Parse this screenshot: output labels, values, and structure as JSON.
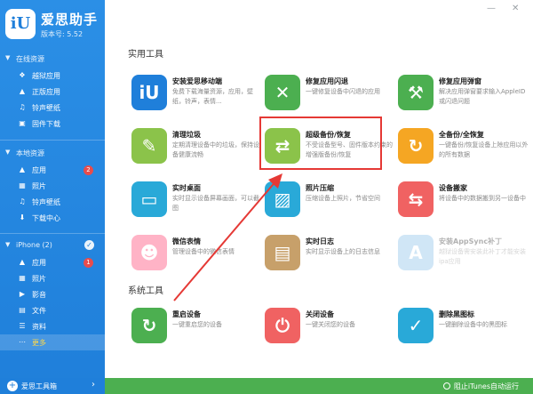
{
  "app": {
    "title": "爱思助手",
    "version": "版本号: 5.52",
    "logo_text": "iU"
  },
  "window_controls": {
    "minimize": "—",
    "close": "✕"
  },
  "sidebar": {
    "sections": [
      {
        "label": "在线资源",
        "items": [
          {
            "label": "越狱应用",
            "icon": "jailbreak-icon",
            "glyph": "❖"
          },
          {
            "label": "正版应用",
            "icon": "apps-icon",
            "glyph": "▲"
          },
          {
            "label": "铃声壁纸",
            "icon": "ringtone-icon",
            "glyph": "♫"
          },
          {
            "label": "固件下载",
            "icon": "firmware-icon",
            "glyph": "▣"
          }
        ]
      },
      {
        "label": "本地资源",
        "items": [
          {
            "label": "应用",
            "icon": "apps-icon",
            "glyph": "▲",
            "badge": "2"
          },
          {
            "label": "照片",
            "icon": "photos-icon",
            "glyph": "▦"
          },
          {
            "label": "铃声壁纸",
            "icon": "ringtone-icon",
            "glyph": "♫"
          },
          {
            "label": "下载中心",
            "icon": "download-icon",
            "glyph": "⬇"
          }
        ]
      },
      {
        "label": "iPhone (2)",
        "items": [
          {
            "label": "应用",
            "icon": "apps-icon",
            "glyph": "▲",
            "badge": "1"
          },
          {
            "label": "照片",
            "icon": "photos-icon",
            "glyph": "▦"
          },
          {
            "label": "影音",
            "icon": "media-icon",
            "glyph": "▶"
          },
          {
            "label": "文件",
            "icon": "files-icon",
            "glyph": "▤"
          },
          {
            "label": "资料",
            "icon": "data-icon",
            "glyph": "☰"
          },
          {
            "label": "更多",
            "icon": "more-icon",
            "glyph": "⋯",
            "active": true
          }
        ]
      }
    ]
  },
  "bottom": {
    "toolbox": "爱思工具箱",
    "itunes": "阻止iTunes自动运行"
  },
  "main": {
    "section1": "实用工具",
    "section2": "系统工具",
    "tools": [
      {
        "name": "安装爱思移动端",
        "desc": "免费下载海量资源，应用，壁纸，铃声，表情...",
        "color": "#1f7fda",
        "glyph": "iU",
        "icon": "aisi-mobile-icon"
      },
      {
        "name": "修复应用闪退",
        "desc": "一键修复设备中闪退的应用",
        "color": "#4caf50",
        "glyph": "✕",
        "icon": "repair-crash-icon"
      },
      {
        "name": "修复应用弹窗",
        "desc": "解决应用弹窗要求输入AppleID或闪退问题",
        "color": "#4caf50",
        "glyph": "⚒",
        "icon": "repair-popup-icon"
      },
      {
        "name": "清理垃圾",
        "desc": "定期清理设备中的垃圾，保持设备健康流畅",
        "color": "#8bc34a",
        "glyph": "✎",
        "icon": "clean-junk-icon"
      },
      {
        "name": "超级备份/恢复",
        "desc": "不受设备型号、固件版本约束的增强版备份/恢复",
        "color": "#8bc34a",
        "glyph": "⇄",
        "icon": "super-backup-icon"
      },
      {
        "name": "全备份/全恢复",
        "desc": "一键备份/恢复设备上除应用以外的所有数据",
        "color": "#f5a623",
        "glyph": "↻",
        "icon": "full-backup-icon"
      },
      {
        "name": "实时桌面",
        "desc": "实时显示设备屏幕画面，可以截图",
        "color": "#29a9d8",
        "glyph": "▭",
        "icon": "live-desktop-icon"
      },
      {
        "name": "照片压缩",
        "desc": "压缩设备上照片，节省空间",
        "color": "#29a9d8",
        "glyph": "▨",
        "icon": "photo-compress-icon"
      },
      {
        "name": "设备搬家",
        "desc": "将设备中的数据搬到另一设备中",
        "color": "#f06262",
        "glyph": "⇆",
        "icon": "device-migrate-icon"
      },
      {
        "name": "微信表情",
        "desc": "管理设备中的微信表情",
        "color": "#ffb3c6",
        "glyph": "☻",
        "icon": "wechat-emoji-icon"
      },
      {
        "name": "实时日志",
        "desc": "实时显示设备上的日志信息",
        "color": "#c7a06a",
        "glyph": "▤",
        "icon": "live-log-icon"
      },
      {
        "name": "安装AppSync补丁",
        "desc": "越狱设备需安装此补丁才能安装ipa应用",
        "color": "#7ab8e8",
        "glyph": "A",
        "icon": "appsync-icon",
        "faded": true
      }
    ],
    "system_tools": [
      {
        "name": "重启设备",
        "desc": "一键重启您的设备",
        "color": "#4caf50",
        "glyph": "↻",
        "icon": "restart-icon"
      },
      {
        "name": "关闭设备",
        "desc": "一键关闭您的设备",
        "color": "#f06262",
        "glyph": "⏻",
        "icon": "power-off-icon"
      },
      {
        "name": "删除黑图标",
        "desc": "一键删除设备中的黑图标",
        "color": "#29a9d8",
        "glyph": "✓",
        "icon": "delete-black-icon"
      }
    ]
  }
}
